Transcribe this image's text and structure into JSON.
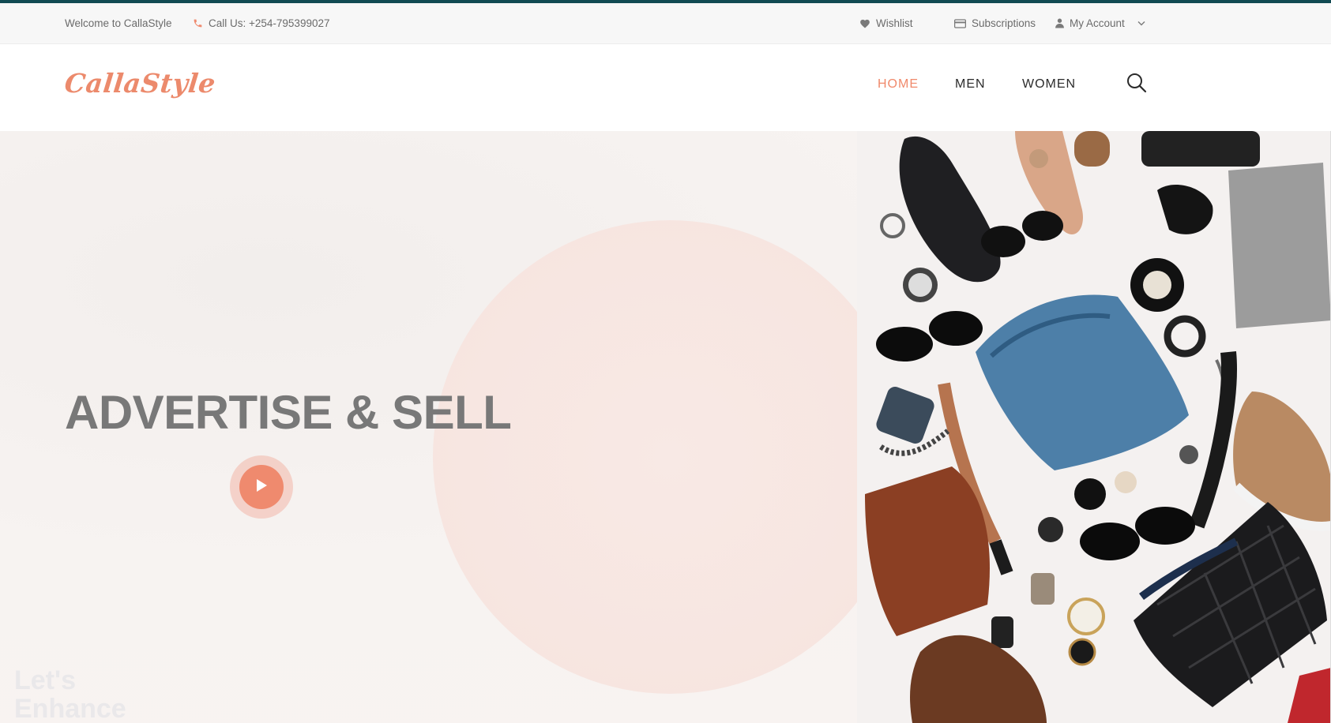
{
  "topbar": {
    "welcome": "Welcome to CallaStyle",
    "phone": "Call Us: +254-795399027",
    "wishlist": "Wishlist",
    "subscriptions": "Subscriptions",
    "account": "My Account"
  },
  "header": {
    "logo": "CallaStyle",
    "nav": [
      "HOME",
      "MEN",
      "WOMEN"
    ],
    "active_nav": "HOME"
  },
  "hero": {
    "title": "ADVERTISE & SELL",
    "ghost_line1": "Let's",
    "ghost_line2": "Enhance"
  },
  "colors": {
    "accent": "#ef8a6e",
    "top_border": "#114a52",
    "nav_active": "#f0896b"
  },
  "icons": [
    "phone-icon",
    "heart-icon",
    "card-icon",
    "user-icon",
    "chevron-down-icon",
    "search-icon",
    "play-icon"
  ]
}
